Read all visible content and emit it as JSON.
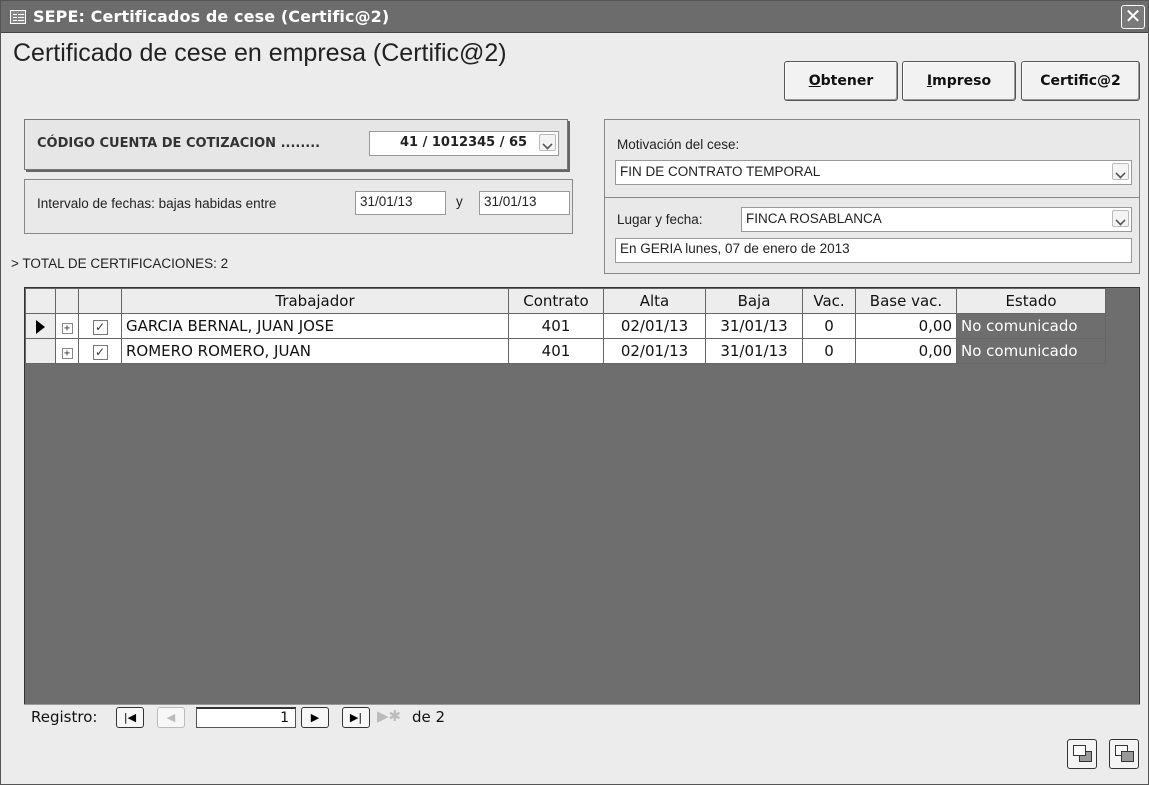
{
  "window": {
    "title": "SEPE: Certificados de cese (Certific@2)",
    "close_label": "✕"
  },
  "form": {
    "title": "Certificado de cese en empresa (Certific@2)"
  },
  "toolbar": {
    "obtener_first": "O",
    "obtener_rest": "btener",
    "impreso_first": "I",
    "impreso_rest": "mpreso",
    "certifica_label": "Certific@2"
  },
  "codigo": {
    "label": "CÓDIGO CUENTA DE COTIZACION ........",
    "value": "41 / 1012345 / 65"
  },
  "intervalo": {
    "label": "Intervalo de fechas: bajas habidas entre",
    "from": "31/01/13",
    "joiner": "y",
    "to": "31/01/13"
  },
  "motivacion": {
    "label": "Motivación del cese:",
    "value": "FIN DE CONTRATO TEMPORAL"
  },
  "lugar": {
    "label": "Lugar y fecha:",
    "value": "FINCA ROSABLANCA",
    "fecha_texto": "En GERIA lunes, 07 de enero de 2013"
  },
  "total": {
    "text": "> TOTAL DE CERTIFICACIONES: 2"
  },
  "grid": {
    "headers": {
      "trabajador": "Trabajador",
      "contrato": "Contrato",
      "alta": "Alta",
      "baja": "Baja",
      "vac": "Vac.",
      "base_vac": "Base vac.",
      "estado": "Estado"
    },
    "rows": [
      {
        "trabajador": "GARCIA BERNAL, JUAN JOSE",
        "contrato": "401",
        "alta": "02/01/13",
        "baja": "31/01/13",
        "vac": "0",
        "base_vac": "0,00",
        "estado": "No comunicado",
        "checked": true
      },
      {
        "trabajador": "ROMERO ROMERO, JUAN",
        "contrato": "401",
        "alta": "02/01/13",
        "baja": "31/01/13",
        "vac": "0",
        "base_vac": "0,00",
        "estado": "No comunicado",
        "checked": true
      }
    ]
  },
  "navigator": {
    "label": "Registro:",
    "current": "1",
    "of_text": "de 2"
  }
}
